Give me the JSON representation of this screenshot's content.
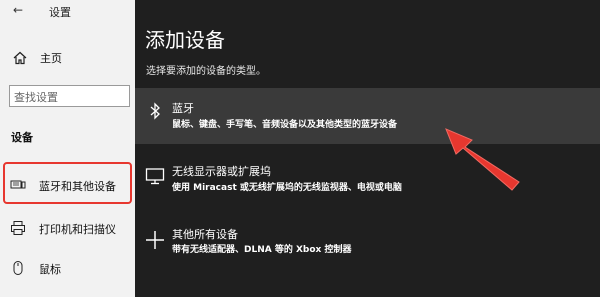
{
  "settings": {
    "back_icon": "back-arrow-icon",
    "title": "设置",
    "home": {
      "label": "主页",
      "icon": "home-icon"
    },
    "search": {
      "placeholder": "查找设置"
    },
    "section_title": "设备",
    "nav_items": [
      {
        "label": "蓝牙和其他设备",
        "icon": "bluetooth-devices-icon",
        "selected": true
      },
      {
        "label": "打印机和扫描仪",
        "icon": "printer-icon"
      },
      {
        "label": "鼠标",
        "icon": "mouse-icon"
      }
    ]
  },
  "dialog": {
    "title": "添加设备",
    "subtitle": "选择要添加的设备的类型。",
    "options": [
      {
        "title": "蓝牙",
        "description": "鼠标、键盘、手写笔、音频设备以及其他类型的蓝牙设备",
        "icon": "bluetooth-icon",
        "selected": true
      },
      {
        "title": "无线显示器或扩展坞",
        "description": "使用 Miracast 或无线扩展坞的无线监视器、电视或电脑",
        "icon": "monitor-icon"
      },
      {
        "title": "其他所有设备",
        "description": "带有无线适配器、DLNA 等的 Xbox 控制器",
        "icon": "plus-icon"
      }
    ]
  },
  "annotations": {
    "highlight_color": "#e7372f",
    "arrow_color": "#e7372f"
  },
  "colors": {
    "dialog_bg": "#1f1f1f",
    "selected_option_bg": "#3a3a3a",
    "left_panel_bg": "#f2f2f2"
  }
}
